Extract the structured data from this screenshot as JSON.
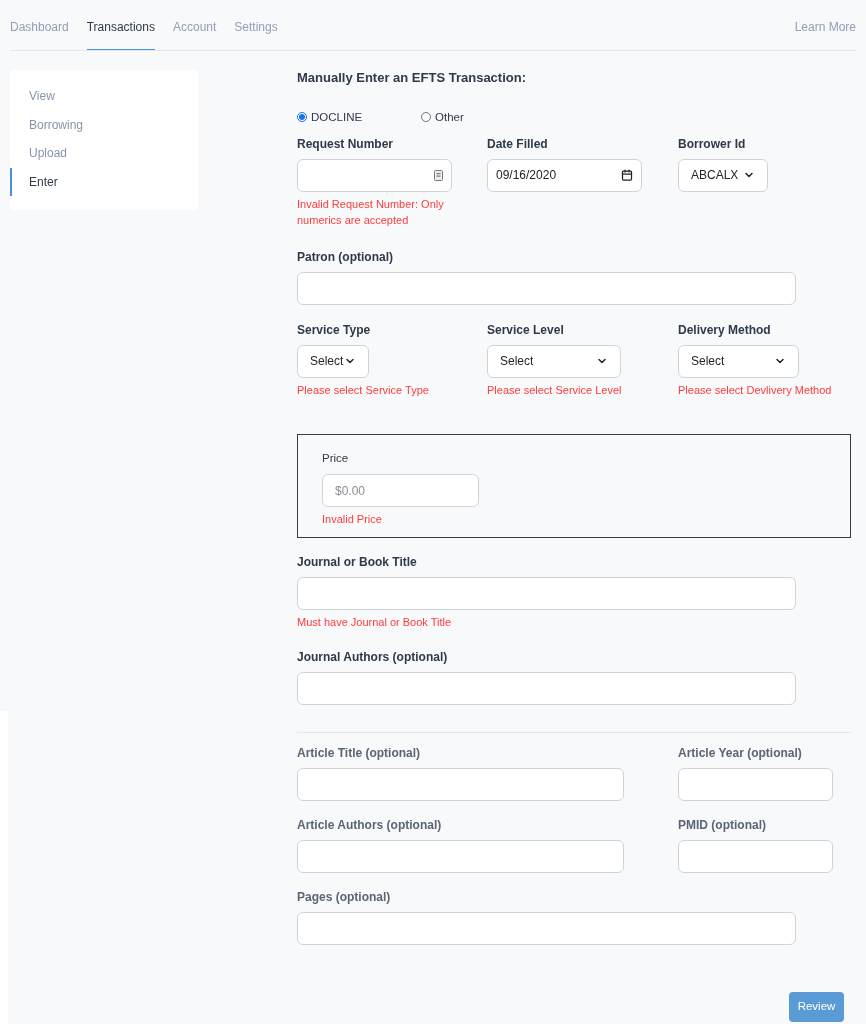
{
  "nav": {
    "tabs": [
      {
        "label": "Dashboard",
        "selected": false
      },
      {
        "label": "Transactions",
        "selected": true
      },
      {
        "label": "Account",
        "selected": false
      },
      {
        "label": "Settings",
        "selected": false
      }
    ],
    "link": "Learn More"
  },
  "sidebar": {
    "items": [
      {
        "label": "View",
        "selected": false
      },
      {
        "label": "Borrowing",
        "selected": false
      },
      {
        "label": "Upload",
        "selected": false
      },
      {
        "label": "Enter",
        "selected": true
      }
    ]
  },
  "form": {
    "title": "Manually Enter an EFTS Transaction:",
    "source": [
      {
        "label": "DOCLINE",
        "selected": true
      },
      {
        "label": "Other",
        "selected": false
      }
    ],
    "request_number": {
      "label": "Request Number",
      "error": "Invalid Request Number: Only numerics are accepted"
    },
    "date_filled": {
      "label": "Date Filled",
      "value": "09/16/2020"
    },
    "borrower_id": {
      "label": "Borrower Id",
      "value": "ABCALX"
    },
    "patron": {
      "label": "Patron (optional)"
    },
    "service_type": {
      "label": "Service Type",
      "value": "Select",
      "error": "Please select Service Type"
    },
    "service_level": {
      "label": "Service Level",
      "value": "Select",
      "error": "Please select Service Level"
    },
    "delivery_method": {
      "label": "Delivery Method",
      "value": "Select",
      "error": "Please select Devlivery Method"
    },
    "price": {
      "label": "Price",
      "placeholder": "$0.00",
      "error": "Invalid Price"
    },
    "journal_title": {
      "label": "Journal or Book Title",
      "error": "Must have Journal or Book Title"
    },
    "journal_authors": {
      "label": "Journal Authors (optional)"
    },
    "article_title": {
      "label": "Article Title (optional)"
    },
    "article_year": {
      "label": "Article Year (optional)"
    },
    "article_authors": {
      "label": "Article Authors (optional)"
    },
    "pmid": {
      "label": "PMID (optional)"
    },
    "pages": {
      "label": "Pages (optional)"
    },
    "submit": "Review"
  }
}
